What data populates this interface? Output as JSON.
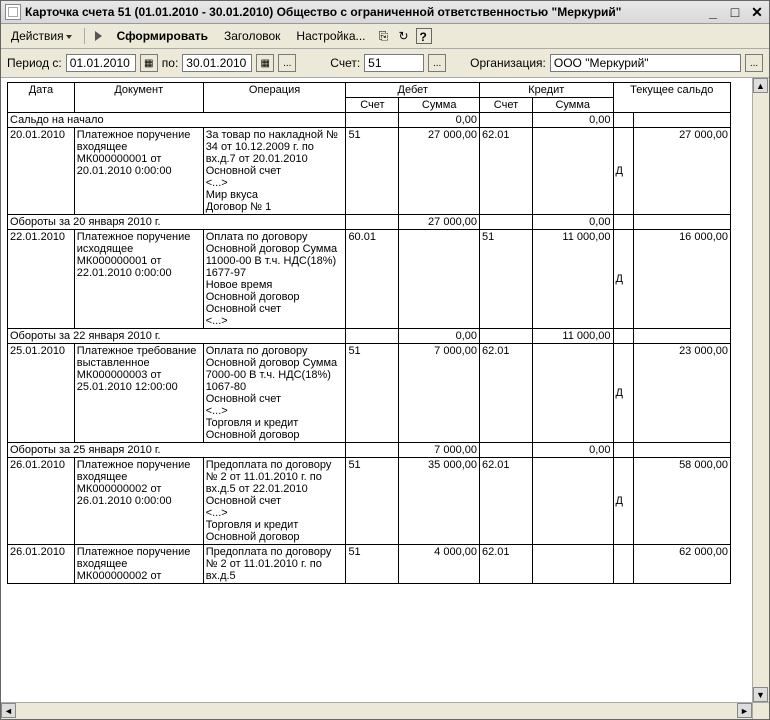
{
  "window": {
    "title": "Карточка счета 51 (01.01.2010 - 30.01.2010) Общество с ограниченной ответственностью \"Меркурий\""
  },
  "toolbar": {
    "actions": "Действия",
    "run": "Сформировать",
    "header": "Заголовок",
    "settings": "Настройка..."
  },
  "params": {
    "period_from_label": "Период с:",
    "period_from": "01.01.2010",
    "period_to_label": "по:",
    "period_to": "30.01.2010",
    "account_label": "Счет:",
    "account": "51",
    "org_label": "Организация:",
    "org": "ООО \"Меркурий\""
  },
  "columns": {
    "date": "Дата",
    "document": "Документ",
    "operation": "Операция",
    "debit": "Дебет",
    "credit": "Кредит",
    "balance": "Текущее сальдо",
    "account": "Счет",
    "sum": "Сумма"
  },
  "opening": {
    "label": "Сальдо на начало",
    "debit_sum": "0,00",
    "credit_sum": "0,00"
  },
  "rows": [
    {
      "date": "20.01.2010",
      "document": "Платежное поручение входящее МК000000001 от 20.01.2010 0:00:00",
      "operation": "За товар по накладной № 34 от 10.12.2009 г. по вх.д.7 от 20.01.2010\nОсновной счет\n<...>\nМир вкуса\nДоговор № 1",
      "d_acc": "51",
      "d_sum": "27 000,00",
      "k_acc": "62.01",
      "k_sum": "",
      "flag": "Д",
      "balance": "27 000,00"
    },
    {
      "subtotal": true,
      "label": "Обороты за 20 января 2010 г.",
      "d_sum": "27 000,00",
      "k_sum": "0,00"
    },
    {
      "date": "22.01.2010",
      "document": "Платежное поручение исходящее МК000000001 от 22.01.2010 0:00:00",
      "operation": "Оплата по договору Основной договор Сумма 11000-00 В т.ч. НДС(18%) 1677-97\nНовое время\nОсновной договор\nОсновной счет\n<...>",
      "d_acc": "60.01",
      "d_sum": "",
      "k_acc": "51",
      "k_sum": "11 000,00",
      "flag": "Д",
      "balance": "16 000,00"
    },
    {
      "subtotal": true,
      "label": "Обороты за 22 января 2010 г.",
      "d_sum": "0,00",
      "k_sum": "11 000,00"
    },
    {
      "date": "25.01.2010",
      "document": "Платежное требование выставленное МК000000003 от 25.01.2010 12:00:00",
      "operation": "Оплата по договору Основной договор Сумма 7000-00 В т.ч. НДС(18%) 1067-80\nОсновной счет\n<...>\nТорговля и кредит\nОсновной договор",
      "d_acc": "51",
      "d_sum": "7 000,00",
      "k_acc": "62.01",
      "k_sum": "",
      "flag": "Д",
      "balance": "23 000,00"
    },
    {
      "subtotal": true,
      "label": "Обороты за 25 января 2010 г.",
      "d_sum": "7 000,00",
      "k_sum": "0,00"
    },
    {
      "date": "26.01.2010",
      "document": "Платежное поручение входящее МК000000002 от 26.01.2010 0:00:00",
      "operation": "Предоплата по договору № 2 от 11.01.2010 г. по вх.д.5 от 22.01.2010\nОсновной счет\n<...>\nТорговля и кредит\nОсновной договор",
      "d_acc": "51",
      "d_sum": "35 000,00",
      "k_acc": "62.01",
      "k_sum": "",
      "flag": "Д",
      "balance": "58 000,00"
    },
    {
      "date": "26.01.2010",
      "document": "Платежное поручение входящее МК000000002 от",
      "operation": "Предоплата по договору № 2 от 11.01.2010 г. по вх.д.5",
      "d_acc": "51",
      "d_sum": "4 000,00",
      "k_acc": "62.01",
      "k_sum": "",
      "flag": "",
      "balance": "62 000,00"
    }
  ]
}
